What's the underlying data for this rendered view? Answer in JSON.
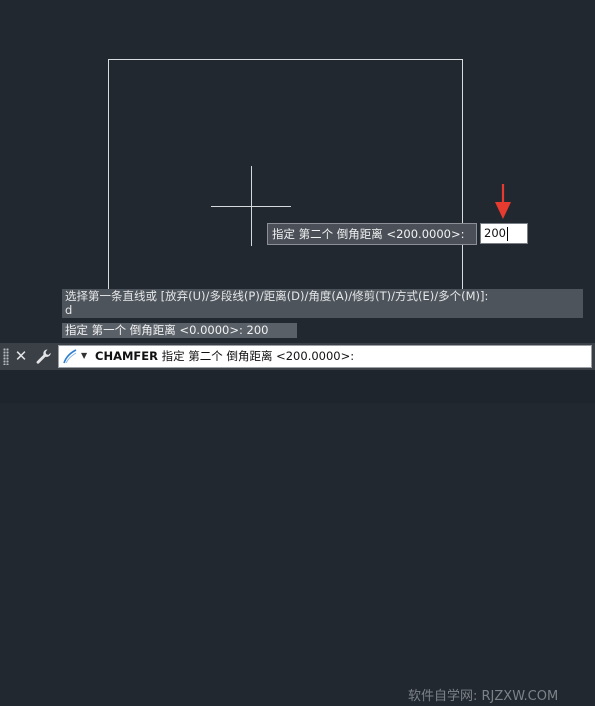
{
  "tooltip": {
    "prompt": "指定 第二个 倒角距离 <200.0000>:"
  },
  "dynamic_input": {
    "value": "200"
  },
  "history": {
    "line1": "选择第一条直线或 [放弃(U)/多段线(P)/距离(D)/角度(A)/修剪(T)/方式(E)/多个(M)]:",
    "line2": "d"
  },
  "last_prompt": "指定 第一个 倒角距离 <0.0000>: 200",
  "command_line": {
    "command": "CHAMFER",
    "prompt": "指定 第二个 倒角距离 <200.0000>:",
    "close_glyph": "✕"
  },
  "watermark": "软件自学网: RJZXW.COM",
  "colors": {
    "background": "#212830",
    "annotation_arrow": "#e63b2e",
    "command_bar": "#3b4047"
  },
  "icons": {
    "close": "close-icon",
    "customize": "wrench-icon",
    "command_prompt": "command-line-icon",
    "recent_commands": "dropdown-arrow-icon"
  }
}
